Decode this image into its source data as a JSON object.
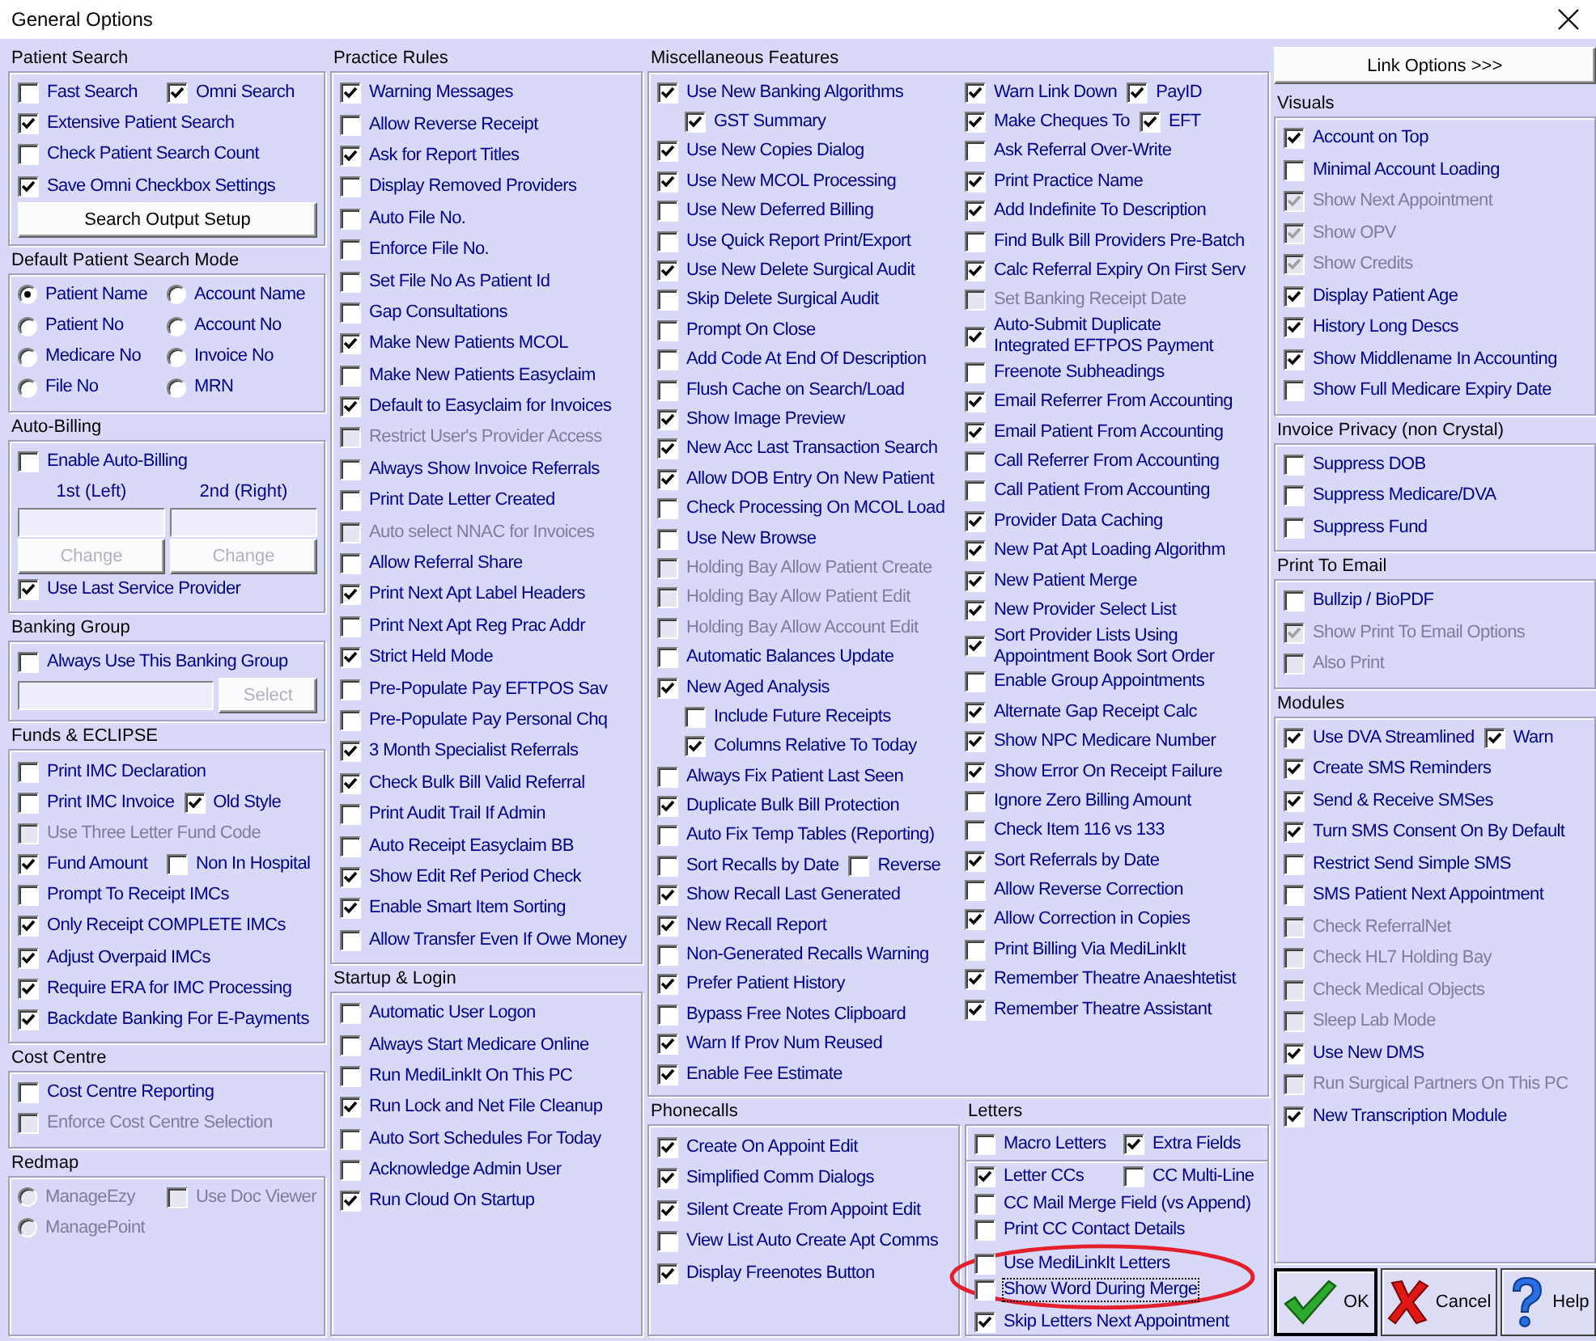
{
  "window": {
    "title": "General Options"
  },
  "left_column": [
    {
      "title": "Patient Search",
      "rows": [
        [
          {
            "kind": "checkbox",
            "label": "Fast Search",
            "checked": false,
            "disabled": false
          },
          {
            "kind": "checkbox",
            "label": "Omni Search",
            "checked": true,
            "disabled": false
          }
        ],
        [
          {
            "kind": "checkbox",
            "label": "Extensive Patient Search",
            "checked": true,
            "disabled": false
          }
        ],
        [
          {
            "kind": "checkbox",
            "label": "Check Patient Search Count",
            "checked": false,
            "disabled": false
          }
        ],
        [
          {
            "kind": "checkbox",
            "label": "Save Omni Checkbox Settings",
            "checked": true,
            "disabled": false
          }
        ],
        [
          {
            "kind": "button",
            "label": "Search Output Setup",
            "disabled": false
          }
        ]
      ]
    },
    {
      "title": "Default Patient Search Mode",
      "rows": [
        [
          {
            "kind": "radio",
            "label": "Patient Name",
            "selected": true,
            "disabled": false
          },
          {
            "kind": "radio",
            "label": "Account Name",
            "selected": false,
            "disabled": false
          }
        ],
        [
          {
            "kind": "radio",
            "label": "Patient No",
            "selected": false,
            "disabled": false
          },
          {
            "kind": "radio",
            "label": "Account No",
            "selected": false,
            "disabled": false
          }
        ],
        [
          {
            "kind": "radio",
            "label": "Medicare No",
            "selected": false,
            "disabled": false
          },
          {
            "kind": "radio",
            "label": "Invoice No",
            "selected": false,
            "disabled": false
          }
        ],
        [
          {
            "kind": "radio",
            "label": "File No",
            "selected": false,
            "disabled": false
          },
          {
            "kind": "radio",
            "label": "MRN",
            "selected": false,
            "disabled": false
          }
        ]
      ]
    },
    {
      "title": "Auto-Billing",
      "rows": [
        [
          {
            "kind": "checkbox",
            "label": "Enable Auto-Billing",
            "checked": false,
            "disabled": false
          }
        ],
        [
          {
            "kind": "caption",
            "label": "1st (Left)"
          },
          {
            "kind": "caption",
            "label": "2nd (Right)"
          }
        ],
        [
          {
            "kind": "field"
          },
          {
            "kind": "field"
          }
        ],
        [
          {
            "kind": "button",
            "label": "Change",
            "disabled": true
          },
          {
            "kind": "button",
            "label": "Change",
            "disabled": true
          }
        ],
        [
          {
            "kind": "checkbox",
            "label": "Use Last Service Provider",
            "checked": true,
            "disabled": false
          }
        ]
      ]
    },
    {
      "title": "Banking Group",
      "rows": [
        [
          {
            "kind": "checkbox",
            "label": "Always Use This Banking Group",
            "checked": false,
            "disabled": false
          }
        ],
        [
          {
            "kind": "field"
          },
          {
            "kind": "button",
            "label": "Select",
            "disabled": true
          }
        ]
      ]
    },
    {
      "title": "Funds & ECLIPSE",
      "rows": [
        [
          {
            "kind": "checkbox",
            "label": "Print IMC Declaration",
            "checked": false,
            "disabled": false
          }
        ],
        [
          {
            "kind": "checkbox",
            "label": "Print IMC Invoice",
            "checked": false,
            "disabled": false
          },
          {
            "kind": "checkbox",
            "label": "Old Style",
            "checked": true,
            "disabled": false
          }
        ],
        [
          {
            "kind": "checkbox",
            "label": "Use Three Letter Fund Code",
            "checked": false,
            "disabled": true
          }
        ],
        [
          {
            "kind": "checkbox",
            "label": "Fund Amount",
            "checked": true,
            "disabled": false
          },
          {
            "kind": "checkbox",
            "label": "Non In Hospital",
            "checked": false,
            "disabled": false
          }
        ],
        [
          {
            "kind": "checkbox",
            "label": "Prompt To Receipt IMCs",
            "checked": false,
            "disabled": false
          }
        ],
        [
          {
            "kind": "checkbox",
            "label": "Only Receipt COMPLETE IMCs",
            "checked": true,
            "disabled": false
          }
        ],
        [
          {
            "kind": "checkbox",
            "label": "Adjust Overpaid IMCs",
            "checked": true,
            "disabled": false
          }
        ],
        [
          {
            "kind": "checkbox",
            "label": "Require ERA for IMC Processing",
            "checked": true,
            "disabled": false
          }
        ],
        [
          {
            "kind": "checkbox",
            "label": "Backdate Banking For E-Payments",
            "checked": true,
            "disabled": false
          }
        ]
      ]
    },
    {
      "title": "Cost Centre",
      "rows": [
        [
          {
            "kind": "checkbox",
            "label": "Cost Centre Reporting",
            "checked": false,
            "disabled": false
          }
        ],
        [
          {
            "kind": "checkbox",
            "label": "Enforce Cost Centre Selection",
            "checked": false,
            "disabled": true
          }
        ]
      ]
    },
    {
      "title": "Redmap",
      "rows": [
        [
          {
            "kind": "radio",
            "label": "ManageEzy",
            "selected": false,
            "disabled": true
          },
          {
            "kind": "checkbox",
            "label": "Use Doc Viewer",
            "checked": false,
            "disabled": true
          }
        ],
        [
          {
            "kind": "radio",
            "label": "ManagePoint",
            "selected": false,
            "disabled": true
          }
        ]
      ]
    }
  ],
  "middle_column": [
    {
      "title": "Practice Rules",
      "rows": [
        [
          {
            "kind": "checkbox",
            "label": "Warning Messages",
            "checked": true,
            "disabled": false
          }
        ],
        [
          {
            "kind": "checkbox",
            "label": "Allow Reverse Receipt",
            "checked": false,
            "disabled": false
          }
        ],
        [
          {
            "kind": "checkbox",
            "label": "Ask for Report Titles",
            "checked": true,
            "disabled": false
          }
        ],
        [
          {
            "kind": "checkbox",
            "label": "Display Removed Providers",
            "checked": false,
            "disabled": false
          }
        ],
        [
          {
            "kind": "checkbox",
            "label": "Auto File No.",
            "checked": false,
            "disabled": false
          }
        ],
        [
          {
            "kind": "checkbox",
            "label": "Enforce File No.",
            "checked": false,
            "disabled": false
          }
        ],
        [
          {
            "kind": "checkbox",
            "label": "Set File No As Patient Id",
            "checked": false,
            "disabled": false
          }
        ],
        [
          {
            "kind": "checkbox",
            "label": "Gap Consultations",
            "checked": false,
            "disabled": false
          }
        ],
        [
          {
            "kind": "checkbox",
            "label": "Make New Patients MCOL",
            "checked": true,
            "disabled": false
          }
        ],
        [
          {
            "kind": "checkbox",
            "label": "Make New Patients Easyclaim",
            "checked": false,
            "disabled": false
          }
        ],
        [
          {
            "kind": "checkbox",
            "label": "Default to Easyclaim for Invoices",
            "checked": true,
            "disabled": false
          }
        ],
        [
          {
            "kind": "checkbox",
            "label": "Restrict User's Provider Access",
            "checked": false,
            "disabled": true
          }
        ],
        [
          {
            "kind": "checkbox",
            "label": "Always Show Invoice Referrals",
            "checked": false,
            "disabled": false
          }
        ],
        [
          {
            "kind": "checkbox",
            "label": "Print Date Letter Created",
            "checked": false,
            "disabled": false
          }
        ],
        [
          {
            "kind": "checkbox",
            "label": "Auto select NNAC for Invoices",
            "checked": false,
            "disabled": true
          }
        ],
        [
          {
            "kind": "checkbox",
            "label": "Allow Referral Share",
            "checked": false,
            "disabled": false
          }
        ],
        [
          {
            "kind": "checkbox",
            "label": "Print Next Apt Label Headers",
            "checked": true,
            "disabled": false
          }
        ],
        [
          {
            "kind": "checkbox",
            "label": "Print Next Apt Reg Prac Addr",
            "checked": false,
            "disabled": false
          }
        ],
        [
          {
            "kind": "checkbox",
            "label": "Strict Held Mode",
            "checked": true,
            "disabled": false
          }
        ],
        [
          {
            "kind": "checkbox",
            "label": "Pre-Populate Pay EFTPOS Sav",
            "checked": false,
            "disabled": false
          }
        ],
        [
          {
            "kind": "checkbox",
            "label": "Pre-Populate Pay Personal Chq",
            "checked": false,
            "disabled": false
          }
        ],
        [
          {
            "kind": "checkbox",
            "label": "3 Month Specialist Referrals",
            "checked": true,
            "disabled": false
          }
        ],
        [
          {
            "kind": "checkbox",
            "label": "Check Bulk Bill Valid Referral",
            "checked": true,
            "disabled": false
          }
        ],
        [
          {
            "kind": "checkbox",
            "label": "Print Audit Trail If Admin",
            "checked": false,
            "disabled": false
          }
        ],
        [
          {
            "kind": "checkbox",
            "label": "Auto Receipt Easyclaim BB",
            "checked": false,
            "disabled": false
          }
        ],
        [
          {
            "kind": "checkbox",
            "label": "Show Edit Ref Period Check",
            "checked": true,
            "disabled": false
          }
        ],
        [
          {
            "kind": "checkbox",
            "label": "Enable Smart Item Sorting",
            "checked": true,
            "disabled": false
          }
        ],
        [
          {
            "kind": "checkbox",
            "label": "Allow Transfer Even If Owe Money",
            "checked": false,
            "disabled": false
          }
        ]
      ]
    },
    {
      "title": "Startup & Login",
      "rows": [
        [
          {
            "kind": "checkbox",
            "label": "Automatic User Logon",
            "checked": false,
            "disabled": false
          }
        ],
        [
          {
            "kind": "checkbox",
            "label": "Always Start Medicare Online",
            "checked": false,
            "disabled": false
          }
        ],
        [
          {
            "kind": "checkbox",
            "label": "Run MediLinkIt On This PC",
            "checked": false,
            "disabled": false
          }
        ],
        [
          {
            "kind": "checkbox",
            "label": "Run Lock and Net File Cleanup",
            "checked": true,
            "disabled": false
          }
        ],
        [
          {
            "kind": "checkbox",
            "label": "Auto Sort Schedules For Today",
            "checked": false,
            "disabled": false
          }
        ],
        [
          {
            "kind": "checkbox",
            "label": "Acknowledge Admin User",
            "checked": false,
            "disabled": false
          }
        ],
        [
          {
            "kind": "checkbox",
            "label": "Run Cloud On Startup",
            "checked": true,
            "disabled": false
          }
        ]
      ]
    }
  ],
  "misc": {
    "title": "Miscellaneous Features",
    "columns": [
      [
        [
          {
            "kind": "checkbox",
            "label": "Use New Banking Algorithms",
            "checked": true,
            "disabled": false,
            "children": [
              {
                "kind": "checkbox",
                "label": "GST Summary",
                "checked": true,
                "disabled": false
              }
            ]
          }
        ],
        [
          {
            "kind": "checkbox",
            "label": "Use New Copies Dialog",
            "checked": true,
            "disabled": false
          }
        ],
        [
          {
            "kind": "checkbox",
            "label": "Use New MCOL Processing",
            "checked": true,
            "disabled": false
          }
        ],
        [
          {
            "kind": "checkbox",
            "label": "Use New Deferred Billing",
            "checked": false,
            "disabled": false
          }
        ],
        [
          {
            "kind": "checkbox",
            "label": "Use Quick Report Print/Export",
            "checked": false,
            "disabled": false
          }
        ],
        [
          {
            "kind": "checkbox",
            "label": "Use New Delete Surgical Audit",
            "checked": true,
            "disabled": false
          }
        ],
        [
          {
            "kind": "checkbox",
            "label": "Skip Delete Surgical Audit",
            "checked": false,
            "disabled": false
          }
        ],
        [
          {
            "kind": "checkbox",
            "label": "Prompt On Close",
            "checked": false,
            "disabled": false
          }
        ],
        [
          {
            "kind": "checkbox",
            "label": "Add Code At End Of Description",
            "checked": false,
            "disabled": false
          }
        ],
        [
          {
            "kind": "checkbox",
            "label": "Flush Cache on Search/Load",
            "checked": false,
            "disabled": false
          }
        ],
        [
          {
            "kind": "checkbox",
            "label": "Show Image Preview",
            "checked": true,
            "disabled": false
          }
        ],
        [
          {
            "kind": "checkbox",
            "label": "New Acc Last Transaction Search",
            "checked": true,
            "disabled": false
          }
        ],
        [
          {
            "kind": "checkbox",
            "label": "Allow DOB Entry On New Patient",
            "checked": true,
            "disabled": false
          }
        ],
        [
          {
            "kind": "checkbox",
            "label": "Check Processing On MCOL Load",
            "checked": false,
            "disabled": false
          }
        ],
        [
          {
            "kind": "checkbox",
            "label": "Use New Browse",
            "checked": false,
            "disabled": false
          }
        ],
        [
          {
            "kind": "checkbox",
            "label": "Holding Bay Allow Patient Create",
            "checked": false,
            "disabled": true
          }
        ],
        [
          {
            "kind": "checkbox",
            "label": "Holding Bay Allow Patient Edit",
            "checked": false,
            "disabled": true
          }
        ],
        [
          {
            "kind": "checkbox",
            "label": "Holding Bay Allow Account Edit",
            "checked": false,
            "disabled": true
          }
        ],
        [
          {
            "kind": "checkbox",
            "label": "Automatic Balances Update",
            "checked": false,
            "disabled": false
          }
        ],
        [
          {
            "kind": "checkbox",
            "label": "New Aged Analysis",
            "checked": true,
            "disabled": false,
            "children": [
              {
                "kind": "checkbox",
                "label": "Include Future Receipts",
                "checked": false,
                "disabled": false
              },
              {
                "kind": "checkbox",
                "label": "Columns Relative To Today",
                "checked": true,
                "disabled": false
              }
            ]
          }
        ],
        [
          {
            "kind": "checkbox",
            "label": "Always Fix Patient Last Seen",
            "checked": false,
            "disabled": false
          }
        ],
        [
          {
            "kind": "checkbox",
            "label": "Duplicate Bulk Bill Protection",
            "checked": true,
            "disabled": false
          }
        ],
        [
          {
            "kind": "checkbox",
            "label": "Auto Fix Temp Tables (Reporting)",
            "checked": false,
            "disabled": false
          }
        ],
        [
          {
            "kind": "checkbox",
            "label": "Sort Recalls by Date",
            "checked": false,
            "disabled": false
          },
          {
            "kind": "checkbox",
            "label": "Reverse",
            "checked": false,
            "disabled": false
          }
        ],
        [
          {
            "kind": "checkbox",
            "label": "Show Recall Last Generated",
            "checked": true,
            "disabled": false
          }
        ],
        [
          {
            "kind": "checkbox",
            "label": "New Recall Report",
            "checked": true,
            "disabled": false
          }
        ],
        [
          {
            "kind": "checkbox",
            "label": "Non-Generated Recalls Warning",
            "checked": false,
            "disabled": false
          }
        ],
        [
          {
            "kind": "checkbox",
            "label": "Prefer Patient History",
            "checked": true,
            "disabled": false
          }
        ],
        [
          {
            "kind": "checkbox",
            "label": "Bypass Free Notes Clipboard",
            "checked": false,
            "disabled": false
          }
        ],
        [
          {
            "kind": "checkbox",
            "label": "Warn If Prov Num Reused",
            "checked": true,
            "disabled": false
          }
        ],
        [
          {
            "kind": "checkbox",
            "label": "Enable Fee Estimate",
            "checked": true,
            "disabled": false
          }
        ]
      ],
      [
        [
          {
            "kind": "checkbox",
            "label": "Warn Link Down",
            "checked": true,
            "disabled": false
          },
          {
            "kind": "checkbox",
            "label": "PayID",
            "checked": true,
            "disabled": false
          }
        ],
        [
          {
            "kind": "checkbox",
            "label": "Make Cheques To",
            "checked": true,
            "disabled": false
          },
          {
            "kind": "checkbox",
            "label": "EFT",
            "checked": true,
            "disabled": false
          }
        ],
        [
          {
            "kind": "checkbox",
            "label": "Ask Referral Over-Write",
            "checked": false,
            "disabled": false
          }
        ],
        [
          {
            "kind": "checkbox",
            "label": "Print Practice Name",
            "checked": true,
            "disabled": false
          }
        ],
        [
          {
            "kind": "checkbox",
            "label": "Add Indefinite To Description",
            "checked": true,
            "disabled": false
          }
        ],
        [
          {
            "kind": "checkbox",
            "label": "Find Bulk Bill Providers Pre-Batch",
            "checked": false,
            "disabled": false
          }
        ],
        [
          {
            "kind": "checkbox",
            "label": "Calc Referral Expiry On First Serv",
            "checked": true,
            "disabled": false
          }
        ],
        [
          {
            "kind": "checkbox",
            "label": "Set Banking Receipt Date",
            "checked": false,
            "disabled": true
          }
        ],
        [
          {
            "kind": "checkbox",
            "label": "Auto-Submit Duplicate Integrated EFTPOS Payment",
            "checked": true,
            "disabled": false
          }
        ],
        [
          {
            "kind": "checkbox",
            "label": "Freenote Subheadings",
            "checked": false,
            "disabled": false
          }
        ],
        [
          {
            "kind": "checkbox",
            "label": "Email Referrer From Accounting",
            "checked": true,
            "disabled": false
          }
        ],
        [
          {
            "kind": "checkbox",
            "label": "Email Patient From Accounting",
            "checked": true,
            "disabled": false
          }
        ],
        [
          {
            "kind": "checkbox",
            "label": "Call Referrer From Accounting",
            "checked": false,
            "disabled": false
          }
        ],
        [
          {
            "kind": "checkbox",
            "label": "Call Patient From Accounting",
            "checked": false,
            "disabled": false
          }
        ],
        [
          {
            "kind": "checkbox",
            "label": "Provider Data Caching",
            "checked": true,
            "disabled": false
          }
        ],
        [
          {
            "kind": "checkbox",
            "label": "New Pat Apt Loading Algorithm",
            "checked": true,
            "disabled": false
          }
        ],
        [
          {
            "kind": "checkbox",
            "label": "New Patient Merge",
            "checked": true,
            "disabled": false
          }
        ],
        [
          {
            "kind": "checkbox",
            "label": "New Provider Select List",
            "checked": true,
            "disabled": false
          }
        ],
        [
          {
            "kind": "checkbox",
            "label": "Sort Provider Lists Using Appointment Book Sort Order",
            "checked": true,
            "disabled": false
          }
        ],
        [
          {
            "kind": "checkbox",
            "label": "Enable Group Appointments",
            "checked": false,
            "disabled": false
          }
        ],
        [
          {
            "kind": "checkbox",
            "label": "Alternate Gap Receipt Calc",
            "checked": true,
            "disabled": false
          }
        ],
        [
          {
            "kind": "checkbox",
            "label": "Show NPC Medicare Number",
            "checked": true,
            "disabled": false
          }
        ],
        [
          {
            "kind": "checkbox",
            "label": "Show Error On Receipt Failure",
            "checked": true,
            "disabled": false
          }
        ],
        [
          {
            "kind": "checkbox",
            "label": "Ignore Zero Billing Amount",
            "checked": false,
            "disabled": false
          }
        ],
        [
          {
            "kind": "checkbox",
            "label": "Check Item 116 vs 133",
            "checked": false,
            "disabled": false
          }
        ],
        [
          {
            "kind": "checkbox",
            "label": "Sort Referrals by Date",
            "checked": true,
            "disabled": false
          }
        ],
        [
          {
            "kind": "checkbox",
            "label": "Allow Reverse Correction",
            "checked": false,
            "disabled": false
          }
        ],
        [
          {
            "kind": "checkbox",
            "label": "Allow Correction in Copies",
            "checked": true,
            "disabled": false
          }
        ],
        [
          {
            "kind": "checkbox",
            "label": "Print Billing Via MediLinkIt",
            "checked": false,
            "disabled": false
          }
        ],
        [
          {
            "kind": "checkbox",
            "label": "Remember Theatre Anaeshtetist",
            "checked": true,
            "disabled": false
          }
        ],
        [
          {
            "kind": "checkbox",
            "label": "Remember Theatre Assistant",
            "checked": true,
            "disabled": false
          }
        ]
      ]
    ]
  },
  "phonecalls": {
    "title": "Phonecalls",
    "rows": [
      [
        {
          "kind": "checkbox",
          "label": "Create On Appoint Edit",
          "checked": true,
          "disabled": false
        }
      ],
      [
        {
          "kind": "checkbox",
          "label": "Simplified Comm Dialogs",
          "checked": true,
          "disabled": false
        }
      ],
      [
        {
          "kind": "checkbox",
          "label": "Silent Create From Appoint Edit",
          "checked": true,
          "disabled": false
        }
      ],
      [
        {
          "kind": "checkbox",
          "label": "View List Auto Create Apt Comms",
          "checked": false,
          "disabled": false
        }
      ],
      [
        {
          "kind": "checkbox",
          "label": "Display Freenotes Button",
          "checked": true,
          "disabled": false
        }
      ]
    ]
  },
  "letters": {
    "title": "Letters",
    "annotation": {
      "kind": "ellipse",
      "color": "#e3202b"
    },
    "sections": [
      [
        [
          {
            "kind": "checkbox",
            "label": "Macro Letters",
            "checked": false,
            "disabled": false,
            "focused": false,
            "circled": false
          },
          {
            "kind": "checkbox",
            "label": "Extra Fields",
            "checked": true,
            "disabled": false,
            "focused": false,
            "circled": false
          }
        ]
      ],
      [
        [
          {
            "kind": "checkbox",
            "label": "Letter CCs",
            "checked": true,
            "disabled": false,
            "focused": false,
            "circled": false
          },
          {
            "kind": "checkbox",
            "label": "CC Multi-Line",
            "checked": false,
            "disabled": false,
            "focused": false,
            "circled": false
          }
        ],
        [
          {
            "kind": "checkbox",
            "label": "CC Mail Merge Field (vs Append)",
            "checked": false,
            "disabled": false,
            "focused": false,
            "circled": false
          }
        ],
        [
          {
            "kind": "checkbox",
            "label": "Print CC Contact Details",
            "checked": false,
            "disabled": false,
            "focused": false,
            "circled": false
          }
        ],
        [
          {
            "kind": "checkbox",
            "label": "Use MediLinkIt Letters",
            "checked": false,
            "disabled": false,
            "focused": false,
            "circled": true
          }
        ],
        [
          {
            "kind": "checkbox",
            "label": "Show Word During Merge",
            "checked": false,
            "disabled": false,
            "focused": true,
            "circled": true
          }
        ],
        [
          {
            "kind": "checkbox",
            "label": "Skip Letters Next Appointment",
            "checked": true,
            "disabled": false,
            "focused": false,
            "circled": false
          }
        ]
      ]
    ]
  },
  "link_options": {
    "label": "Link Options >>>"
  },
  "right_column": [
    {
      "title": "Visuals",
      "rows": [
        [
          {
            "kind": "checkbox",
            "label": "Account on Top",
            "checked": true,
            "disabled": false
          }
        ],
        [
          {
            "kind": "checkbox",
            "label": "Minimal Account Loading",
            "checked": false,
            "disabled": false
          }
        ],
        [
          {
            "kind": "checkbox",
            "label": "Show Next Appointment",
            "checked": true,
            "disabled": true
          }
        ],
        [
          {
            "kind": "checkbox",
            "label": "Show OPV",
            "checked": true,
            "disabled": true
          }
        ],
        [
          {
            "kind": "checkbox",
            "label": "Show Credits",
            "checked": true,
            "disabled": true
          }
        ],
        [
          {
            "kind": "checkbox",
            "label": "Display Patient Age",
            "checked": true,
            "disabled": false
          }
        ],
        [
          {
            "kind": "checkbox",
            "label": "History Long Descs",
            "checked": true,
            "disabled": false
          }
        ],
        [
          {
            "kind": "checkbox",
            "label": "Show Middlename In Accounting",
            "checked": true,
            "disabled": false
          }
        ],
        [
          {
            "kind": "checkbox",
            "label": "Show Full Medicare Expiry Date",
            "checked": false,
            "disabled": false
          }
        ]
      ]
    },
    {
      "title": "Invoice Privacy (non Crystal)",
      "rows": [
        [
          {
            "kind": "checkbox",
            "label": "Suppress DOB",
            "checked": false,
            "disabled": false
          }
        ],
        [
          {
            "kind": "checkbox",
            "label": "Suppress Medicare/DVA",
            "checked": false,
            "disabled": false
          }
        ],
        [
          {
            "kind": "checkbox",
            "label": "Suppress Fund",
            "checked": false,
            "disabled": false
          }
        ]
      ]
    },
    {
      "title": "Print To Email",
      "rows": [
        [
          {
            "kind": "checkbox",
            "label": "Bullzip / BioPDF",
            "checked": false,
            "disabled": false
          }
        ],
        [
          {
            "kind": "checkbox",
            "label": "Show Print To Email Options",
            "checked": true,
            "disabled": true
          }
        ],
        [
          {
            "kind": "checkbox",
            "label": "Also Print",
            "checked": false,
            "disabled": true
          }
        ]
      ]
    },
    {
      "title": "Modules",
      "rows": [
        [
          {
            "kind": "checkbox",
            "label": "Use DVA Streamlined",
            "checked": true,
            "disabled": false
          },
          {
            "kind": "checkbox",
            "label": "Warn",
            "checked": true,
            "disabled": false
          }
        ],
        [
          {
            "kind": "checkbox",
            "label": "Create SMS Reminders",
            "checked": true,
            "disabled": false
          }
        ],
        [
          {
            "kind": "checkbox",
            "label": "Send & Receive SMSes",
            "checked": true,
            "disabled": false
          }
        ],
        [
          {
            "kind": "checkbox",
            "label": "Turn SMS Consent On By Default",
            "checked": true,
            "disabled": false
          }
        ],
        [
          {
            "kind": "checkbox",
            "label": "Restrict Send Simple SMS",
            "checked": false,
            "disabled": false
          }
        ],
        [
          {
            "kind": "checkbox",
            "label": "SMS Patient Next Appointment",
            "checked": false,
            "disabled": false
          }
        ],
        [
          {
            "kind": "checkbox",
            "label": "Check ReferralNet",
            "checked": false,
            "disabled": true
          }
        ],
        [
          {
            "kind": "checkbox",
            "label": "Check HL7 Holding Bay",
            "checked": false,
            "disabled": true
          }
        ],
        [
          {
            "kind": "checkbox",
            "label": "Check Medical Objects",
            "checked": false,
            "disabled": true
          }
        ],
        [
          {
            "kind": "checkbox",
            "label": "Sleep Lab Mode",
            "checked": false,
            "disabled": true
          }
        ],
        [
          {
            "kind": "checkbox",
            "label": "Use New DMS",
            "checked": true,
            "disabled": false
          }
        ],
        [
          {
            "kind": "checkbox",
            "label": "Run Surgical Partners On This PC",
            "checked": false,
            "disabled": true
          }
        ],
        [
          {
            "kind": "checkbox",
            "label": "New Transcription Module",
            "checked": true,
            "disabled": false
          }
        ]
      ]
    }
  ],
  "dialog_buttons": [
    {
      "kind": "ok",
      "label": "OK",
      "default": true
    },
    {
      "kind": "cancel",
      "label": "Cancel",
      "default": false
    },
    {
      "kind": "help",
      "label": "Help",
      "default": false
    }
  ]
}
